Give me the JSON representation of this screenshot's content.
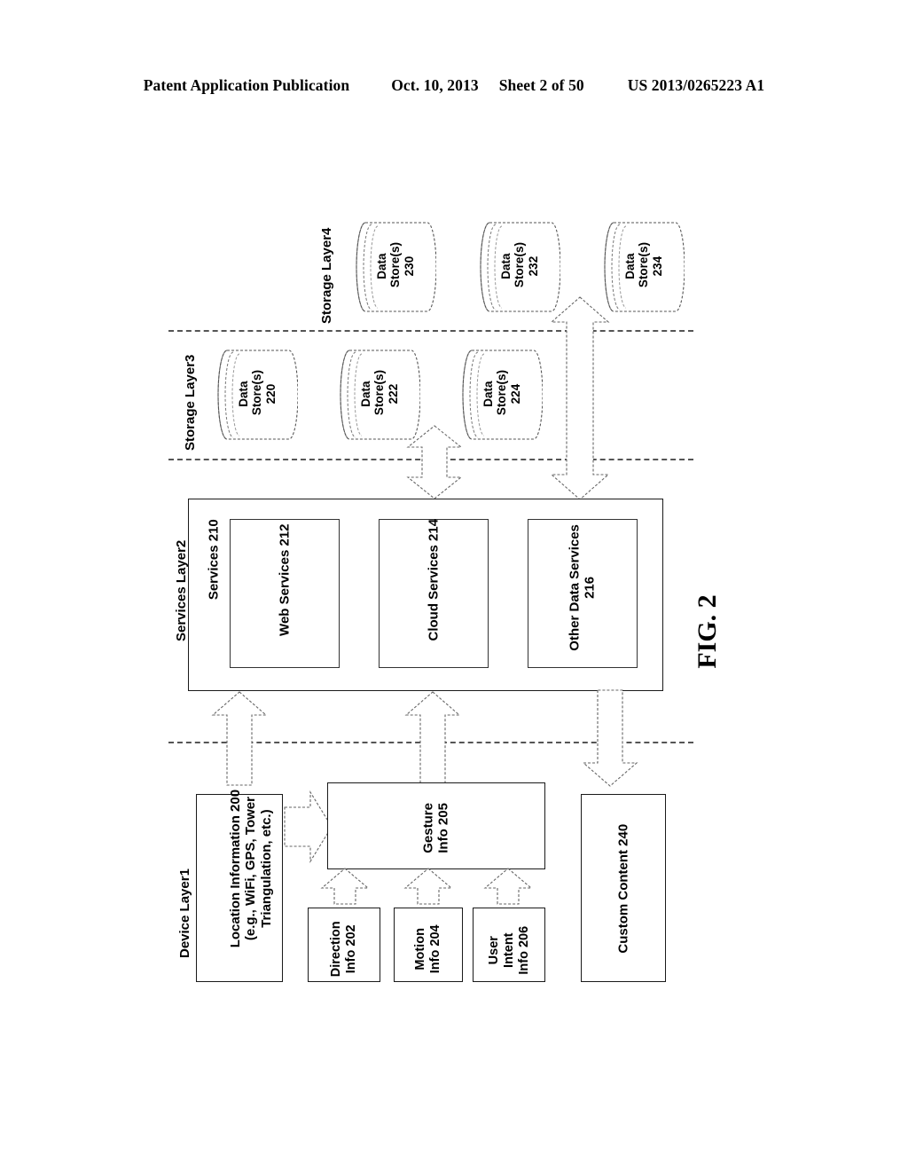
{
  "header": {
    "publication": "Patent Application Publication",
    "date": "Oct. 10, 2013",
    "sheet": "Sheet 2 of 50",
    "docket": "US 2013/0265223 A1"
  },
  "figure": {
    "caption": "FIG. 2",
    "layers": [
      {
        "id": "storage4",
        "label": "Storage Layer4"
      },
      {
        "id": "storage3",
        "label": "Storage Layer3"
      },
      {
        "id": "services2",
        "label": "Services Layer2"
      },
      {
        "id": "device1",
        "label": "Device Layer1"
      }
    ],
    "storage_layer4": {
      "stores": [
        {
          "name": "Data\nStore(s)\n230",
          "ref": "230"
        },
        {
          "name": "Data\nStore(s)\n232",
          "ref": "232"
        },
        {
          "name": "Data\nStore(s)\n234",
          "ref": "234"
        }
      ]
    },
    "storage_layer3": {
      "stores": [
        {
          "name": "Data\nStore(s)\n220",
          "ref": "220"
        },
        {
          "name": "Data\nStore(s)\n222",
          "ref": "222"
        },
        {
          "name": "Data\nStore(s)\n224",
          "ref": "224"
        }
      ]
    },
    "services_layer2": {
      "container_label": "Services 210",
      "services": [
        {
          "label": "Web Services 212",
          "ref": "212"
        },
        {
          "label": "Cloud Services 214",
          "ref": "214"
        },
        {
          "label": "Other Data Services\n216",
          "ref": "216"
        }
      ]
    },
    "device_layer1": {
      "location": "Location Information 200\n(e.g., WiFi, GPS, Tower\nTriangulation, etc.)",
      "gesture": "Gesture\nInfo 205",
      "inputs": [
        {
          "label": "Direction\nInfo 202",
          "ref": "202"
        },
        {
          "label": "Motion\nInfo 204",
          "ref": "204"
        },
        {
          "label": "User\nIntent\nInfo 206",
          "ref": "206"
        }
      ]
    },
    "custom_content": "Custom Content 240",
    "colors": {
      "line": "#1a1a1a",
      "divider": "#555555",
      "background": "#ffffff"
    }
  }
}
